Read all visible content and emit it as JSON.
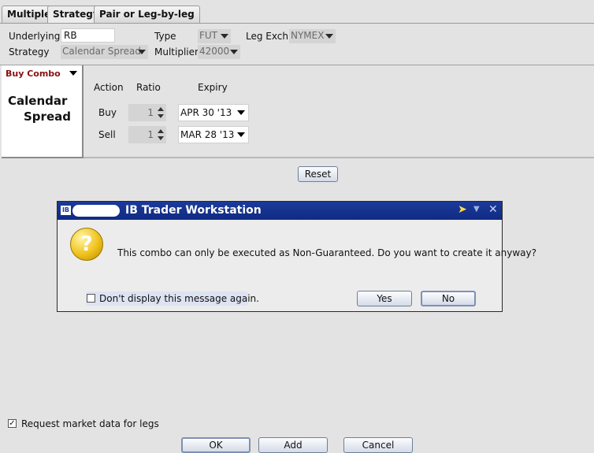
{
  "tabs": [
    {
      "label": "Multiple"
    },
    {
      "label": "Strategy"
    },
    {
      "label": "Pair or Leg-by-leg"
    }
  ],
  "form": {
    "underlying_label": "Underlying",
    "underlying_value": "RB",
    "type_label": "Type",
    "type_value": "FUT",
    "leg_exch_label": "Leg Exch",
    "leg_exch_value": "NYMEX",
    "strategy_label": "Strategy",
    "strategy_value": "Calendar Spread",
    "multiplier_label": "Multiplier",
    "multiplier_value": "42000"
  },
  "combo": {
    "action_selector": "Buy Combo",
    "name_line1": "Calendar",
    "name_line2": "Spread",
    "headers": {
      "action": "Action",
      "ratio": "Ratio",
      "expiry": "Expiry"
    },
    "legs": [
      {
        "action": "Buy",
        "ratio": "1",
        "expiry": "APR 30 '13"
      },
      {
        "action": "Sell",
        "ratio": "1",
        "expiry": "MAR 28 '13"
      }
    ],
    "reset_label": "Reset"
  },
  "dialog": {
    "app_icon": "IB",
    "title": "IB Trader Workstation",
    "icon": "question-icon",
    "icon_glyph": "?",
    "message": "This combo can only be executed as Non-Guaranteed. Do you want to create it anyway?",
    "dont_display_label": "Don't display this message again.",
    "dont_display_checked": false,
    "yes_label": "Yes",
    "no_label": "No"
  },
  "footer": {
    "request_market_data_label": "Request market data for legs",
    "request_market_data_checked": true,
    "ok_label": "OK",
    "add_label": "Add",
    "cancel_label": "Cancel"
  },
  "colors": {
    "title_bar": "#1c3a98",
    "buy_combo_text": "#8a1010",
    "background": "#e3e3e3"
  }
}
